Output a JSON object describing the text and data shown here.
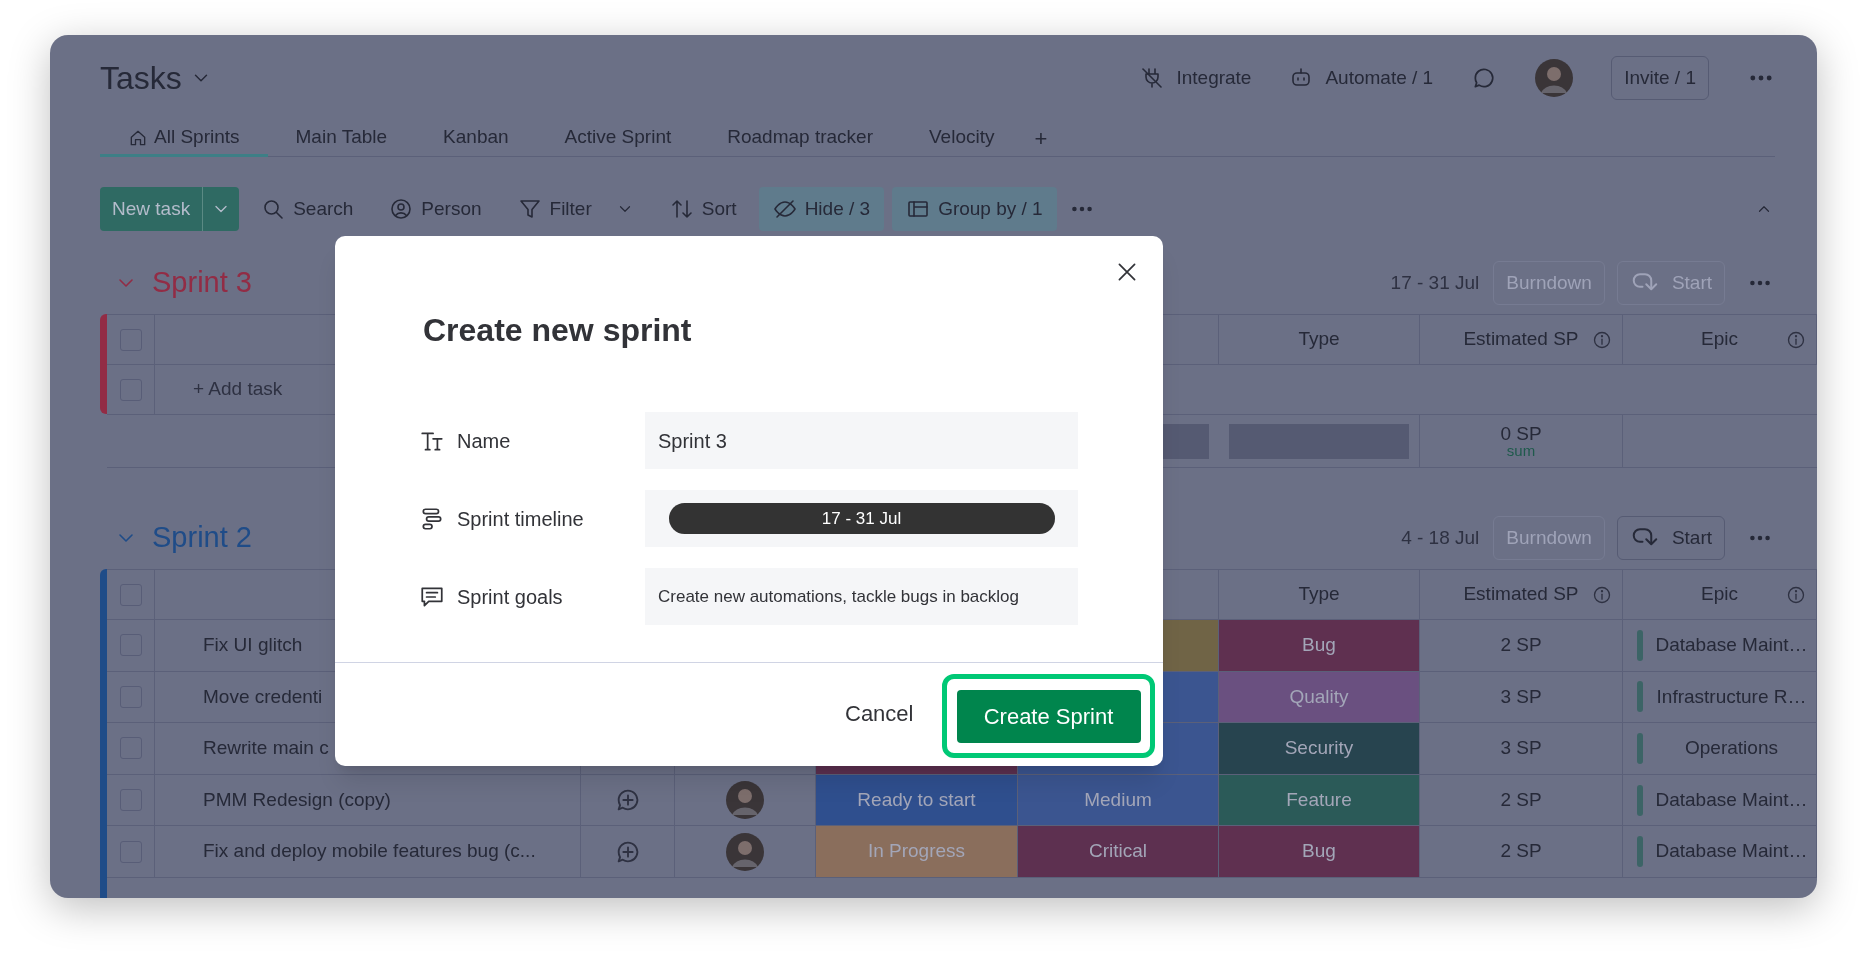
{
  "header": {
    "title": "Tasks",
    "actions": [
      {
        "kind": "integrate",
        "label": "Integrate"
      },
      {
        "kind": "automate",
        "label": "Automate / 1"
      }
    ],
    "invite": "Invite / 1"
  },
  "tabs": [
    {
      "label": "All Sprints",
      "selected": true
    },
    {
      "label": "Main Table",
      "selected": false
    },
    {
      "label": "Kanban",
      "selected": false
    },
    {
      "label": "Active Sprint",
      "selected": false
    },
    {
      "label": "Roadmap tracker",
      "selected": false
    },
    {
      "label": "Velocity",
      "selected": false
    }
  ],
  "add_tab": "+",
  "toolbar": {
    "new_task": "New task",
    "items": [
      {
        "kind": "search",
        "label": "Search",
        "active": false
      },
      {
        "kind": "person",
        "label": "Person",
        "active": false
      },
      {
        "kind": "filter",
        "label": "Filter",
        "active": false
      },
      {
        "kind": "sort",
        "label": "Sort",
        "active": false
      },
      {
        "kind": "hide",
        "label": "Hide / 3",
        "active": true
      },
      {
        "kind": "group",
        "label": "Group by / 1",
        "active": true
      }
    ]
  },
  "groups": [
    {
      "name": "Sprint 3",
      "color": "#922c45",
      "dates": "17 - 31 Jul",
      "burndown": "Burndown",
      "start": {
        "label": "Start",
        "disabled": true
      },
      "select_all": false,
      "columns": [
        {
          "label": "Type",
          "info": false
        },
        {
          "label": "Estimated SP",
          "info": true
        },
        {
          "label": "Epic",
          "info": true
        }
      ],
      "add_task": {
        "label": "+ Add task",
        "checked": false
      },
      "summary": {
        "estimate": "0 SP",
        "caption": "sum"
      }
    },
    {
      "name": "Sprint 2",
      "color": "#1f4c88",
      "dates": "4 - 18 Jul",
      "burndown": "Burndown",
      "start": {
        "label": "Start",
        "disabled": false
      },
      "select_all": false,
      "columns": [
        {
          "label": "Type",
          "info": false
        },
        {
          "label": "Estimated SP",
          "info": true
        },
        {
          "label": "Epic",
          "info": true
        }
      ],
      "rows": [
        {
          "task": "Fix UI glitch",
          "checked": false,
          "priority": {
            "color": "#706446"
          },
          "type": {
            "label": "Bug",
            "color": "#5f3050"
          },
          "estimate": "2 SP",
          "epic": "Database Maint…"
        },
        {
          "task": "Move credenti",
          "checked": false,
          "priority": {
            "color": "#3b5590"
          },
          "type": {
            "label": "Quality",
            "color": "#6a5080"
          },
          "estimate": "3 SP",
          "epic": "Infrastructure R…"
        },
        {
          "task": "Rewrite main c",
          "checked": false,
          "status": {
            "color": "#5d3050"
          },
          "priority": {
            "color": "#3b5590"
          },
          "type": {
            "label": "Security",
            "color": "#27444f"
          },
          "estimate": "3 SP",
          "epic": "Operations"
        },
        {
          "task": "PMM Redesign (copy)",
          "checked": false,
          "chat": true,
          "avatar": true,
          "status": {
            "label": "Ready to start",
            "color": "#2f4f8e"
          },
          "priority": {
            "label": "Medium",
            "color": "#3b5590"
          },
          "type": {
            "label": "Feature",
            "color": "#2b5a58"
          },
          "estimate": "2 SP",
          "epic": "Database Maint…"
        },
        {
          "task": "Fix and deploy mobile features bug (c...",
          "checked": false,
          "chat": true,
          "avatar": true,
          "status": {
            "label": "In Progress",
            "color": "#8a6e5c"
          },
          "priority": {
            "label": "Critical",
            "color": "#5d3050"
          },
          "type": {
            "label": "Bug",
            "color": "#5f3050"
          },
          "estimate": "2 SP",
          "epic": "Database Maint…"
        }
      ]
    }
  ],
  "dialog": {
    "title": "Create new sprint",
    "fields": [
      {
        "kind": "name",
        "label": "Name",
        "value": "Sprint 3"
      },
      {
        "kind": "timeline",
        "label": "Sprint timeline",
        "value": "17 - 31 Jul"
      },
      {
        "kind": "goals",
        "label": "Sprint goals",
        "value": "Create new automations, tackle bugs in backlog"
      }
    ],
    "cancel": "Cancel",
    "submit": "Create Sprint"
  }
}
